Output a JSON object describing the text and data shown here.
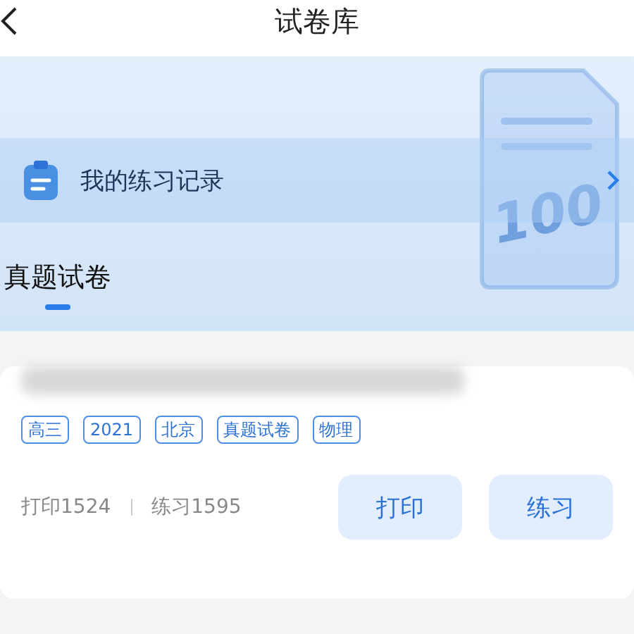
{
  "nav": {
    "title": "试卷库"
  },
  "banner": {
    "score": "100"
  },
  "record": {
    "label": "我的练习记录"
  },
  "tabs": [
    {
      "label": "真题试卷",
      "selected": true
    }
  ],
  "paper": {
    "tags": [
      "高三",
      "2021",
      "北京",
      "真题试卷",
      "物理"
    ],
    "stats": [
      "打印1524",
      "练习1595"
    ],
    "buttons": [
      "打印",
      "练习"
    ]
  }
}
